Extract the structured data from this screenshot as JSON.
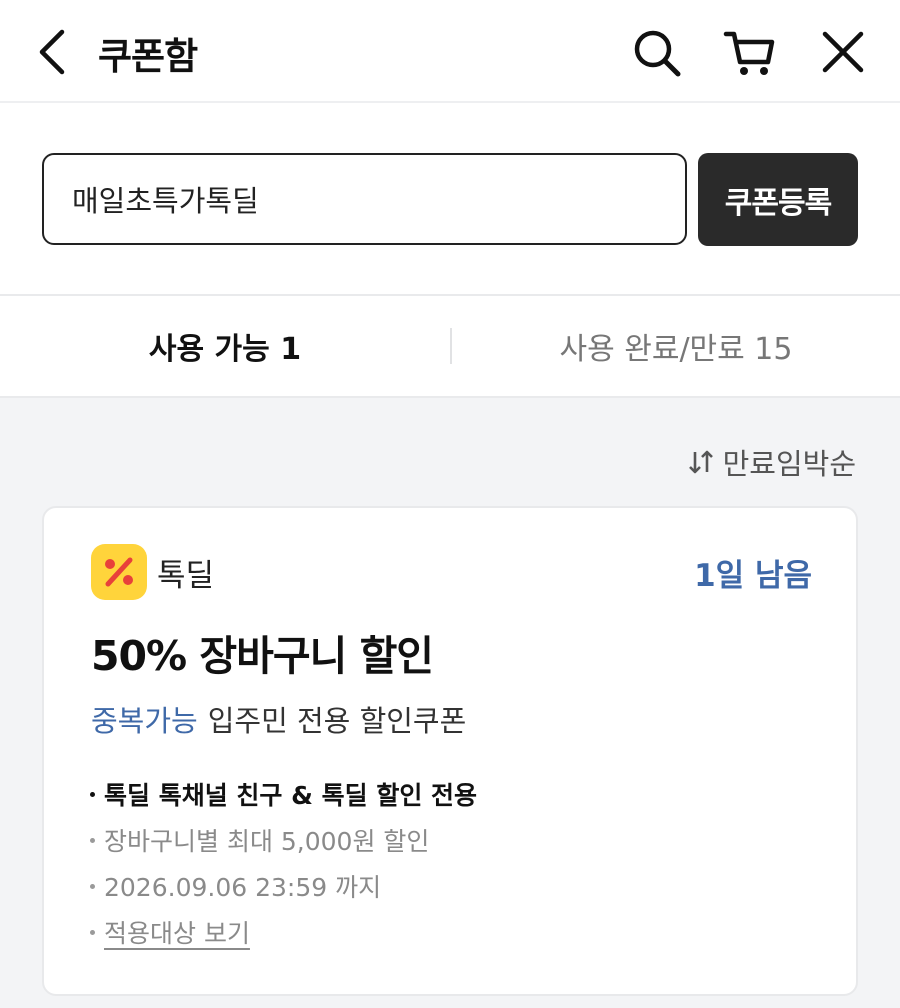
{
  "header": {
    "title": "쿠폰함",
    "icons": [
      "back-icon",
      "search-icon",
      "cart-icon",
      "close-icon"
    ]
  },
  "register": {
    "input_value": "매일초특가톡딜",
    "button_label": "쿠폰등록"
  },
  "tabs": [
    {
      "label": "사용 가능 1",
      "selected": true
    },
    {
      "label": "사용 완료/만료 15",
      "selected": false
    }
  ],
  "sort": {
    "icon": "sort-arrows-icon",
    "label": "만료임박순"
  },
  "coupon": {
    "brand_icon": "percent-icon",
    "brand": "톡딜",
    "days_left": "1일 남음",
    "title": "50% 장바구니 할인",
    "stack_tag": "중복가능",
    "subtitle": "입주민 전용 할인쿠폰",
    "conditions": [
      "톡딜 톡채널 친구 & 톡딜 할인 전용",
      "장바구니별 최대 5,000원 할인",
      "2026.09.06 23:59 까지"
    ],
    "link": "적용대상 보기"
  },
  "colors": {
    "accent_blue": "#3f69a8",
    "brand_yellow": "#ffd43b",
    "brand_red": "#e8413a",
    "button_dark": "#2a2a2a"
  }
}
